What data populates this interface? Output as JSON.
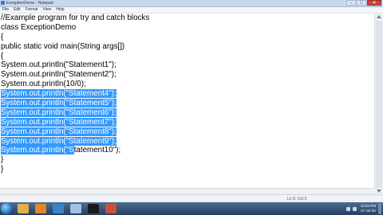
{
  "window": {
    "title": "ExceptionDemo - Notepad",
    "minimize": "–",
    "maximize": "□",
    "close": "✕"
  },
  "menu": [
    "File",
    "Edit",
    "Format",
    "View",
    "Help"
  ],
  "code": [
    {
      "text": "//Example program for try and catch blocks",
      "selected": false
    },
    {
      "text": "class ExceptionDemo",
      "selected": false
    },
    {
      "text": "{",
      "selected": false
    },
    {
      "text": "public static void main(String args[])",
      "selected": false
    },
    {
      "text": "{",
      "selected": false
    },
    {
      "text": "System.out.println(\"Statement1\");",
      "selected": false
    },
    {
      "text": "System.out.println(\"Statement2\");",
      "selected": false
    },
    {
      "text": "System.out.println(10/0);",
      "selected": false
    },
    {
      "text": "System.out.println(\"Statement4\");",
      "selected": true
    },
    {
      "text": "System.out.println(\"Statement5\");",
      "selected": true
    },
    {
      "text": "System.out.println(\"Statement6\");",
      "selected": true
    },
    {
      "text": "System.out.println(\"Statement7\");",
      "selected": true
    },
    {
      "text": "System.out.println(\"Statement8\");",
      "selected": true
    },
    {
      "text": "System.out.println(\"Statement9\");",
      "selected": true
    },
    {
      "text": "System.out.println(\"Statement10\");",
      "selected": "partial",
      "split": 21
    },
    {
      "text": "}",
      "selected": false
    },
    {
      "text": "}",
      "selected": false
    }
  ],
  "status": {
    "text": "Ln 8, Col 3"
  },
  "taskbar": {
    "apps": [
      {
        "icon": "explorer-icon",
        "color": "#e3b04b"
      },
      {
        "icon": "media-player-icon",
        "color": "#e2872c"
      },
      {
        "icon": "browser-icon",
        "color": "#3a83c9"
      },
      {
        "icon": "notepad-icon",
        "color": "#9fc3e7"
      },
      {
        "icon": "cmd-icon",
        "color": "#1a1a1a"
      },
      {
        "icon": "paint-icon",
        "color": "#c94f3f"
      }
    ],
    "time": "12:04 PM",
    "date": "27-Jul-20"
  }
}
